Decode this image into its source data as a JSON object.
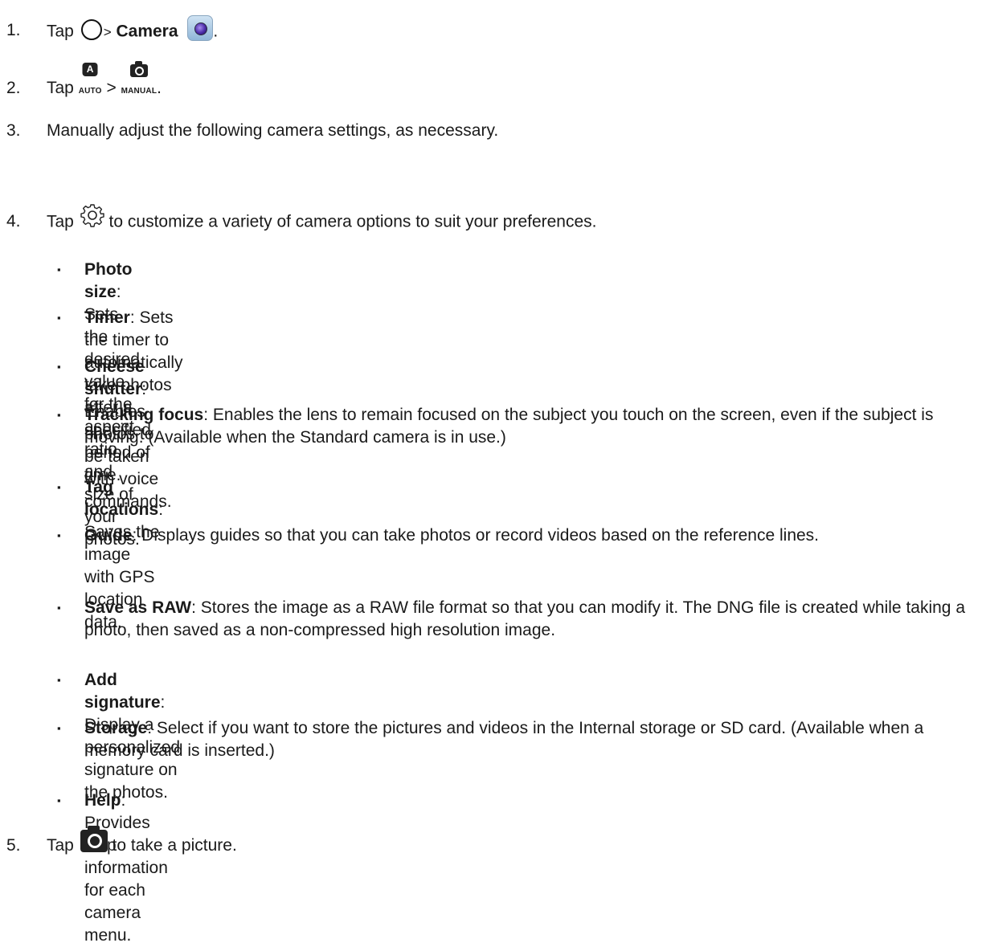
{
  "steps": [
    {
      "number": "1.",
      "tap": "Tap",
      "separator": ">",
      "target": "Camera",
      "period": "."
    },
    {
      "number": "2.",
      "tap": "Tap",
      "mode_from": "AUTO",
      "mode_from_badge": "A",
      "separator": ">",
      "mode_to": "MANUAL",
      "period": "."
    },
    {
      "number": "3.",
      "text": "Manually adjust the following camera settings, as necessary."
    },
    {
      "number": "4.",
      "tap": "Tap",
      "text": "to customize a variety of camera options to suit your preferences."
    },
    {
      "number": "5.",
      "tap": "Tap",
      "text": "to take a picture."
    }
  ],
  "bullet_symbol": "▪",
  "options": [
    {
      "name": "Photo size",
      "desc": ": Sets the desired value for the aspect ratio and size of your photos."
    },
    {
      "name": "Timer",
      "desc": ": Sets the timer to automatically take photos after a specified period of time."
    },
    {
      "name": "Cheese shutter",
      "desc": ": Enables photos to be taken with voice commands."
    },
    {
      "name": "Tracking focus",
      "desc": ": Enables the lens to remain focused on the subject you touch on the screen, even if the subject is moving. (Available when the Standard camera is in use.)"
    },
    {
      "name": "Tag locations",
      "desc": ": Saves the image with GPS location data."
    },
    {
      "name": "Guide",
      "desc": ": Displays guides so that you can take photos or record videos based on the reference lines."
    },
    {
      "name": "Save as RAW",
      "desc": ": Stores the image as a RAW file format so that you can modify it. The DNG file is created while taking a photo, then saved as a non-compressed high resolution image."
    },
    {
      "name": "Add signature",
      "desc": ": Display a personalized signature on the photos."
    },
    {
      "name": "Storage",
      "desc": ": Select if you want to store the pictures and videos in the Internal storage or SD card. (Available when a memory card is inserted.)"
    },
    {
      "name": "Help",
      "desc": ": Provides help information for each camera menu."
    }
  ],
  "icons": {
    "home": "home-button-icon",
    "camera_app": "camera-app-icon",
    "auto_mode": "auto-mode-icon",
    "manual_mode": "manual-mode-icon",
    "settings": "gear-icon",
    "shutter": "camera-shutter-icon"
  }
}
